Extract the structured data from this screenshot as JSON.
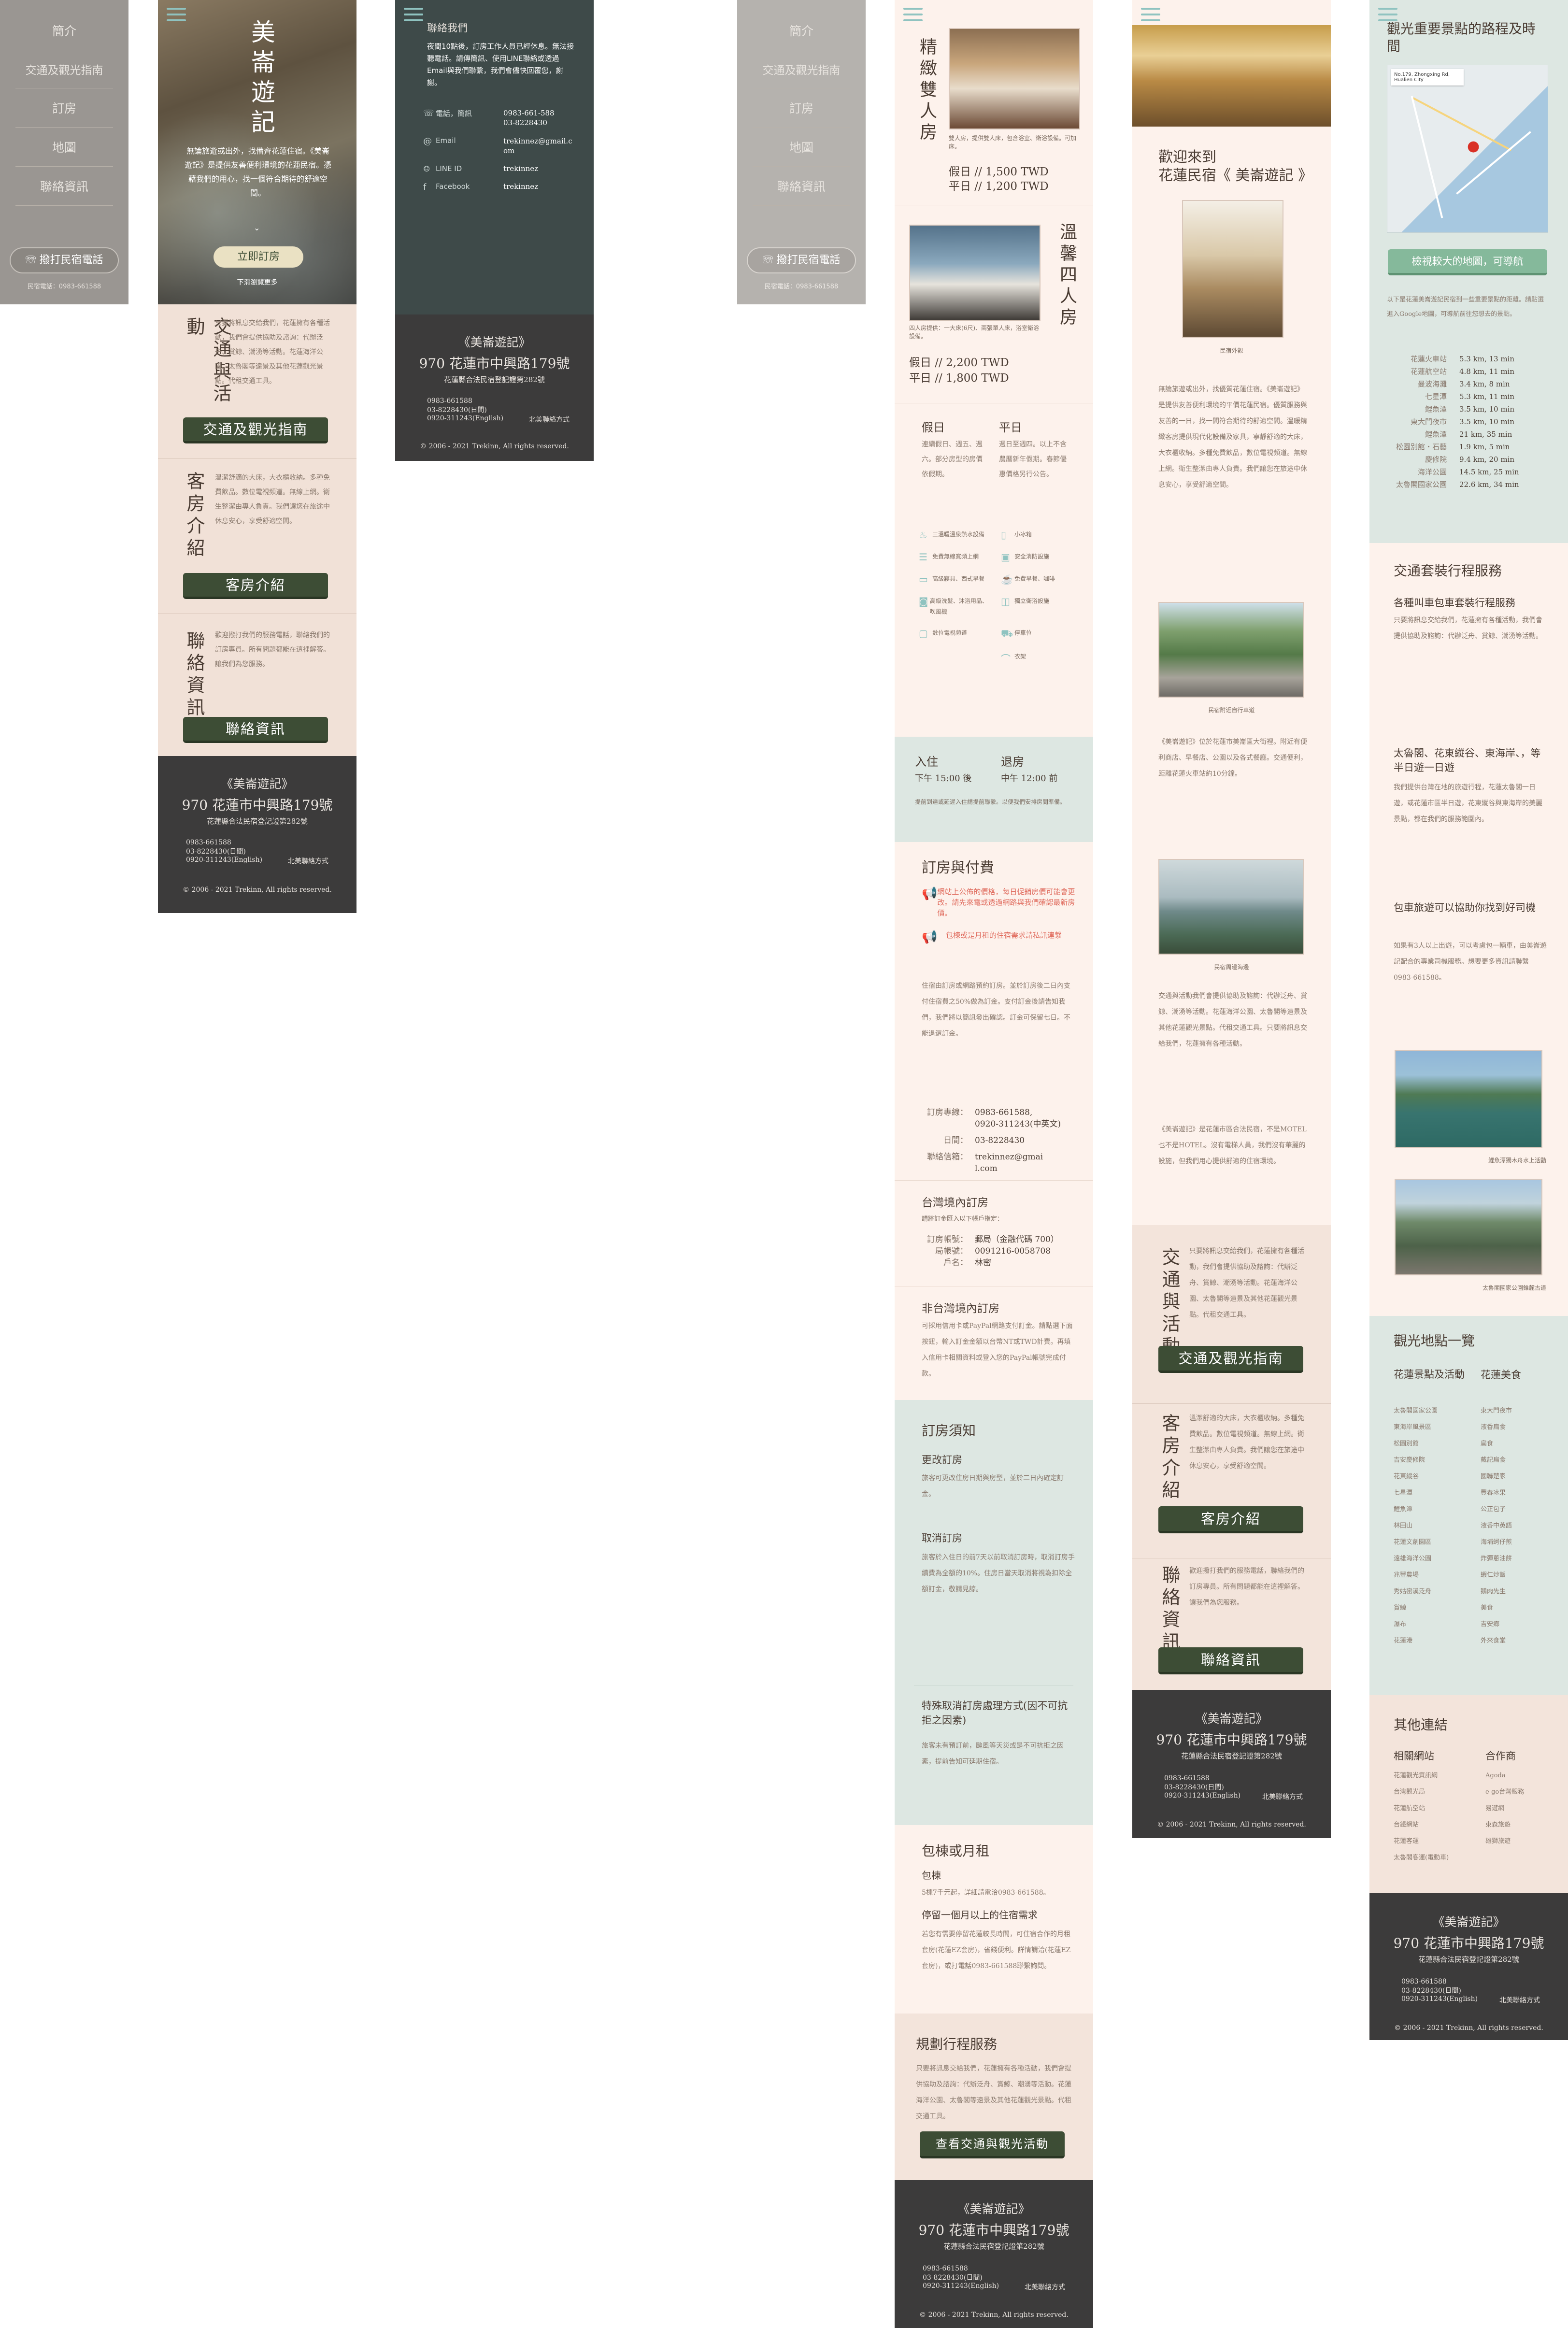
{
  "brand": {
    "name": "美崙遊記",
    "name_quoted": "《美崙遊記》",
    "address": "970 花蓮市中興路179號",
    "license": "花蓮縣合法民宿登記證第282號",
    "phone1": "0983-661588",
    "phone2": "03-8228430(日間)",
    "phone3": "0920-311243(English)",
    "footer_link": "北美聯絡方式",
    "copyright": "© 2006 - 2021 Trekinn, All rights reserved."
  },
  "menu": {
    "items": [
      "簡介",
      "交通及觀光指南",
      "訂房",
      "地圖",
      "聯絡資訊"
    ],
    "call_button": "撥打民宿電話",
    "call_phone": "民宿電話：0983-661588"
  },
  "hero": {
    "title": "美崙遊記",
    "intro": "無論旅遊或出外，找備齊花蓮住宿。《美崙遊記》是提供友善便利環境的花蓮民宿。憑藉我們的用心，找一個符合期待的舒適空間。",
    "book_button": "立即訂房",
    "more_link": "下滑瀏覽更多"
  },
  "sections": {
    "traffic": {
      "title": "交通與活動",
      "text": "只要將訊息交給我們，花蓮擁有各種活動，我們會提供協助及諮詢：代辦泛舟、賞鯨、潮湧等活動。花蓮海洋公園、太魯閣等遠景及其他花蓮觀光景點。代租交通工具。",
      "button": "交通及觀光指南"
    },
    "rooms": {
      "title": "客房介紹",
      "text": "溫潔舒適的大床，大衣櫃收納。多種免費飲品。數位電視頻道。無線上網。衛生整潔由專人負責。我們讓您在旅途中休息安心，享受舒適空間。",
      "button": "客房介紹"
    },
    "contact": {
      "title": "聯絡資訊",
      "text": "歡迎撥打我們的服務電話，聯絡我們的訂房專員。所有問題都能在這裡解答。讓我們為您服務。",
      "button": "聯絡資訊"
    }
  },
  "contact_page": {
    "heading": "聯絡我們",
    "intro": "夜間10點後，訂房工作人員已經休息。無法接聽電話。請傳簡訊、使用LINE聯絡或透過Email與我們聯繫，我們會儘快回覆您，謝謝。",
    "rows": [
      {
        "label": "電話，簡訊",
        "value": "0983-661-588\n03-8228430"
      },
      {
        "label": "Email",
        "value": "trekinnez@gmail.com"
      },
      {
        "label": "LINE ID",
        "value": "trekinnez"
      },
      {
        "label": "Facebook",
        "value": "trekinnez"
      }
    ]
  },
  "room_page": {
    "double": {
      "title": "精緻雙人房",
      "caption": "雙人房，提供雙人床，包含浴室、衛浴設備。可加床。",
      "holiday": "假日 // 1,500 TWD",
      "weekday": "平日 // 1,200 TWD"
    },
    "quad": {
      "title": "溫馨四人房",
      "caption": "四人房提供：一大床(6尺)、兩張單人床，浴室衛浴設備。",
      "holiday": "假日 // 2,200 TWD",
      "weekday": "平日 // 1,800 TWD"
    },
    "days": {
      "holiday_title": "假日",
      "holiday_text": "連續假日、週五、週六。部分房型的房價依假期。",
      "weekday_title": "平日",
      "weekday_text": "週日至週四。以上不含農曆新年假期。春節優惠價格另行公告。"
    },
    "amenities": [
      "三溫暖溫泉熱水設備",
      "小冰箱",
      "免費無線寬頻上網",
      "安全消防設施",
      "高級寢具、西式早餐",
      "免費早餐、咖啡",
      "高級洗髮、沐浴用品、吹風機",
      "獨立衛浴設施",
      "數位電視頻道",
      "停車位",
      "衣架"
    ],
    "checkin": {
      "in_label": "入住",
      "in_time": "下午 15:00 後",
      "out_label": "退房",
      "out_time": "中午 12:00 前",
      "note": "提前到達或延遲入住請提前聯繫。以便我們安排房間準備。"
    },
    "booking": {
      "title": "訂房與付費",
      "alert1": "網站上公佈的價格，每日促銷房價可能會更改。請先來電或透過網路與我們確認最新房價。",
      "alert2": "包棟或是月租的住宿需求請私訊連繫",
      "text": "住宿由訂房或網路預約訂房。並於訂房後二日內支付住宿費之50%做為訂金。支付訂金後請告知我們，我們將以簡訊發出確認。訂金可保留七日。不能退還訂金。",
      "rows": [
        {
          "label": "訂房專線：",
          "value": "0983-661588,\n0920-311243(中英文)"
        },
        {
          "label": "日間：",
          "value": "03-8228430"
        },
        {
          "label": "聯絡信箱：",
          "value": "trekinnez@gmail.com"
        }
      ]
    },
    "domestic": {
      "title": "台灣境內訂房",
      "sub": "請將訂金匯入以下帳戶指定：",
      "rows": [
        {
          "label": "訂房帳號：",
          "value": "郵局（金融代碼 700）"
        },
        {
          "label": "局帳號：",
          "value": "0091216-0058708"
        },
        {
          "label": "戶名：",
          "value": "林密"
        }
      ]
    },
    "foreign": {
      "title": "非台灣境內訂房",
      "text": "可採用信用卡或PayPal網路支付訂金。請點選下面按鈕，輸入訂金金額以台幣NT或TWD計費。再填入信用卡相關資料或登入您的PayPal帳號完成付款。"
    },
    "notice": {
      "title": "訂房須知",
      "change_title": "更改訂房",
      "change_text": "旅客可更改住房日期與房型，並於二日內確定訂金。",
      "cancel_title": "取消訂房",
      "cancel_text": "旅客於入住日的前7天以前取消訂房時，取消訂房手續費為全額的10%。住房日當天取消將視為扣除全額訂金，敬請見諒。",
      "special_title": "特殊取消訂房處理方式(因不可抗拒之因素)",
      "special_text": "旅客未有預訂前，颱風等天災或是不可抗拒之因素，提前告知可延期住宿。"
    },
    "lease": {
      "title": "包棟或月租",
      "sub1": "包棟",
      "text1": "5棟7千元起，詳細請電洽0983-661588。",
      "sub2": "停留一個月以上的住宿需求",
      "text2": "若您有需要停留花蓮較長時間，可住宿合作的月租套房(花蓮EZ套房)，省錢便利。詳情請洽(花蓮EZ套房)，或打電話0983-661588聯繫詢問。"
    },
    "tour": {
      "title": "規劃行程服務",
      "text": "只要將訊息交給我們，花蓮擁有各種活動，我們會提供協助及諮詢：代辦泛舟、賞鯨、潮湧等活動。花蓮海洋公園、太魯閣等遠景及其他花蓮觀光景點。代租交通工具。",
      "button": "查看交通與觀光活動"
    }
  },
  "welcome_page": {
    "title1": "歡迎來到",
    "title2": "花蓮民宿《 美崙遊記 》",
    "photo1_caption": "民宿外觀",
    "text1": "無論旅遊或出外，找優質花蓮住宿。《美崙遊記》是提供友善便利環境的平價花蓮民宿。優質服務與友善的一日，找一間符合期待的舒適空間。溫暖精緻客房提供現代化設備及家具，寧靜舒適的大床，大衣櫃收納。多種免費飲品，數位電視頻道。無線上網。衛生整潔由專人負責。我們讓您在旅途中休息安心，享受舒適空間。",
    "photo2_caption": "民宿附近自行車道",
    "text2": "《美崙遊記》位於花蓮市美崙區大街裡。附近有便利商店、早餐店、公園以及各式餐廳。交通便利，距離花蓮火車站約10分鐘。",
    "photo3_caption": "民宿周邊海邊",
    "text3": "交通與活動我們會提供協助及諮詢：代辦泛舟、賞鯨、潮湧等活動。花蓮海洋公園、太魯閣等遠景及其他花蓮觀光景點。代租交通工具。只要將訊息交給我們，花蓮擁有各種活動。",
    "text4": "《美崙遊記》是花蓮市區合法民宿，不是MOTEL也不是HOTEL。沒有電梯人員，我們沒有華麗的設施，但我們用心提供舒適的住宿環境。"
  },
  "map_page": {
    "title": "觀光重要景點的路程及時間",
    "map_address": "No.179, Zhongxing Rd, Hualien City",
    "map_button": "檢視較大的地圖，可導航",
    "intro": "以下是花蓮美崙遊記民宿到一些重要景點的距離。請點選進入Google地圖，可導航前往您想去的景點。",
    "distances": [
      {
        "place": "花蓮火車站",
        "value": "5.3 km, 13 min"
      },
      {
        "place": "花蓮航空站",
        "value": "4.8 km, 11 min"
      },
      {
        "place": "曼波海灘",
        "value": "3.4 km, 8 min"
      },
      {
        "place": "七星潭",
        "value": "5.3 km, 11 min"
      },
      {
        "place": "鯉魚潭",
        "value": "3.5 km, 10 min"
      },
      {
        "place": "東大門夜市",
        "value": "3.5 km, 10 min"
      },
      {
        "place": "鯉魚潭",
        "value": "21 km, 35 min"
      },
      {
        "place": "松園別館‧石藝",
        "value": "1.9 km, 5 min"
      },
      {
        "place": "慶修院",
        "value": "9.4 km, 20 min"
      },
      {
        "place": "海洋公園",
        "value": "14.5 km, 25 min"
      },
      {
        "place": "太魯閣國家公園",
        "value": "22.6 km, 34 min"
      }
    ],
    "service": {
      "title": "交通套裝行程服務",
      "sub1": "各種叫車包車套裝行程服務",
      "text1": "只要將訊息交給我們，花蓮擁有各種活動，我們會提供協助及諮詢：代辦泛舟、賞鯨、潮湧等活動。",
      "sub2": "太魯閣、花東縱谷、東海岸、，等半日遊一日遊",
      "text2": "我們提供台灣在地的旅遊行程，花蓮太魯閣一日遊，或花蓮市區半日遊，花東縱谷與東海岸的美麗景點，都在我們的服務範圍內。",
      "sub3": "包車旅遊可以協助你找到好司機",
      "text3": "如果有3人以上出遊，可以考慮包一輛車，由美崙遊記配合的專業司機服務。想要更多資訊請聯繫0983-661588。",
      "photo1_caption": "鯉魚潭獨木舟水上活動",
      "photo2_caption": "太魯閣國家公園錐麓古道"
    },
    "spots": {
      "title": "觀光地點一覽",
      "col1_title": "花蓮景點及活動",
      "col1": [
        "太魯閣國家公園",
        "東海岸風景區",
        "松園別館",
        "吉安慶修院",
        "花東縱谷",
        "七星潭",
        "鯉魚潭",
        "林田山",
        "花蓮文創園區",
        "遠雄海洋公園",
        "兆豐農場",
        "秀姑巒溪泛舟",
        "賞鯨",
        "瀑布",
        "花蓮港"
      ],
      "col2_title": "花蓮美食",
      "col2": [
        "東大門夜市",
        "液香扁食",
        "扁食",
        "戴記扁食",
        "國聯楚家",
        "豐春冰果",
        "公正包子",
        "液香中英語",
        "海埔蚵仔煎",
        "炸彈蔥油餅",
        "蝦仁炒飯",
        "鵝肉先生",
        "美食",
        "吉安鄉",
        "外來食堂"
      ]
    },
    "links": {
      "title": "其他連結",
      "col1_title": "相關網站",
      "col1": [
        "花蓮觀光資訊網",
        "台灣觀光局",
        "花蓮航空站",
        "台鐵網站",
        "花蓮客運",
        "太魯閣客運(電動車)"
      ],
      "col2_title": "合作商",
      "col2": [
        "Agoda",
        "e-go台灣服務",
        "易遊網",
        "東森旅遊",
        "雄獅旅遊"
      ]
    }
  },
  "colors": {
    "green_button": "#3d4d35",
    "footer": "#3c3b3b",
    "menu_gray": "#9a9692",
    "dark_teal": "#3e4a49",
    "shade": "#f3e4db",
    "mint": "#dde7e2",
    "accent": "#8fc3c0"
  },
  "icons": [
    "hamburger-icon",
    "phone-icon",
    "email-icon",
    "line-icon",
    "facebook-icon",
    "megaphone-icon",
    "chevron-down-icon",
    "bed-icon",
    "wifi-icon",
    "fridge-icon",
    "shower-icon",
    "tv-icon",
    "car-icon"
  ]
}
